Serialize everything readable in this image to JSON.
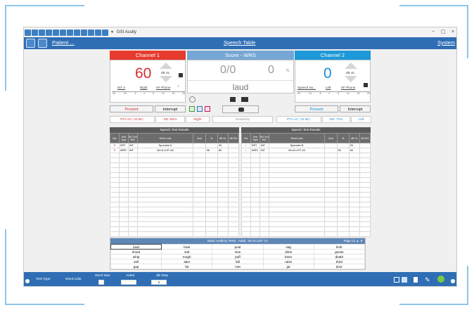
{
  "app": {
    "title": "GSI Acuity",
    "win_controls": [
      "−",
      "▢",
      "×"
    ]
  },
  "nav": {
    "patient": "Patient ...",
    "speech_table": "Speech Table",
    "system": "System"
  },
  "channel1": {
    "title": "Channel 1",
    "level": "60",
    "unit": "dB HL",
    "transducer": "INT A",
    "ear": "Right",
    "output": "HF Phone",
    "present": "Present",
    "interrupt": "Interrupt",
    "color": "#e63b2e"
  },
  "score": {
    "title": "Score - WRS",
    "fraction": "0/0",
    "percent": "0",
    "pct_symbol": "%",
    "word": "laud",
    "color": "#76a7d4"
  },
  "channel2": {
    "title": "Channel 2",
    "level": "0",
    "unit": "dB HL",
    "transducer": "Speech No...",
    "ear": "Left",
    "output": "HF Phone",
    "present": "Present",
    "interrupt": "Interrupt",
    "color": "#1d98d8"
  },
  "scale_ticks": [
    "-20",
    "-10",
    "-5",
    "0",
    "5",
    "10",
    "15",
    "20"
  ],
  "pta": {
    "left_pta": "PTA AC: 23 BC:",
    "left_sr": "SR: 60%",
    "left_ear": "Right",
    "reliability": "Reliability",
    "right_pta": "PTA AC: 22 BC:",
    "right_sr": "SR: 72%",
    "right_ear": "Left"
  },
  "results": {
    "title": "Speech Test Results",
    "headers": [
      "Ear",
      "Test Type",
      "INT Ext MIC",
      "Word Lists",
      "Aud",
      "%",
      "dB HL",
      "dB EM"
    ],
    "left_rows": [
      [
        "R",
        "SRT",
        "INT",
        "Spondee A",
        "",
        "",
        "20",
        ""
      ],
      [
        "R",
        "WRS",
        "INT",
        "NU-6 LIST 4A",
        "",
        "96",
        "60",
        ""
      ]
    ],
    "right_rows": [
      [
        "L",
        "SRT",
        "INT",
        "Spondee B",
        "",
        "",
        "20",
        ""
      ],
      [
        "L",
        "WRS",
        "INT",
        "NU-6 LIST 2A",
        "",
        "90",
        "60",
        ""
      ]
    ]
  },
  "wordlist": {
    "title": "Basic Auditory Tests - Adult : NU-6 LIST 1A",
    "page": "Page 1/2",
    "words": [
      [
        "laud",
        "boat",
        "pool",
        "nag",
        "limb"
      ],
      [
        "shout",
        "sub",
        "vine",
        "dime",
        "goose"
      ],
      [
        "whip",
        "tough",
        "puff",
        "keen",
        "death"
      ],
      [
        "sell",
        "take",
        "fall",
        "raise",
        "third"
      ],
      [
        "gap",
        "fat",
        "met",
        "jar",
        "door"
      ]
    ]
  },
  "bottom": {
    "test_type": "Test Type",
    "word_lists": "Word Lists",
    "word_max": "Word Max",
    "aided": "Aided",
    "db_step": "dB Step",
    "db_step_val": "5"
  }
}
